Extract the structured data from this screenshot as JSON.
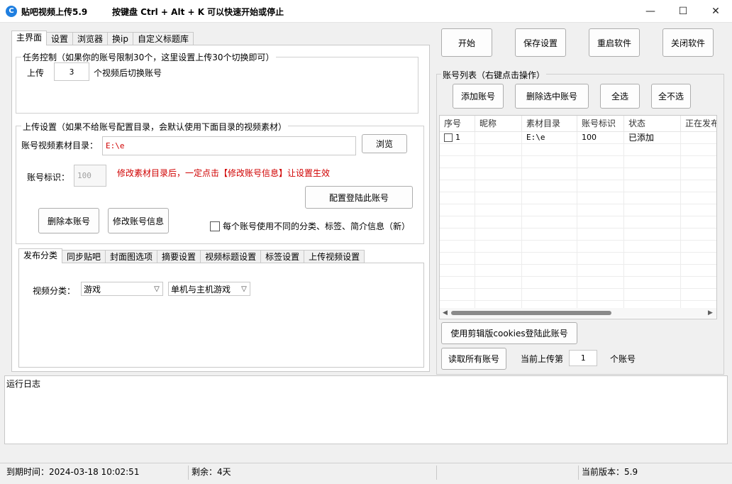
{
  "window": {
    "title": "贴吧视频上传5.9",
    "hotkey_hint": "按键盘 Ctrl + Alt + K  可以快速开始或停止",
    "icon_text": "C",
    "minimize": "—",
    "maximize": "☐",
    "close": "✕"
  },
  "main_tabs": [
    "主界面",
    "设置",
    "浏览器",
    "换ip",
    "自定义标题库"
  ],
  "task_control": {
    "legend": "任务控制（如果你的账号限制30个，这里设置上传30个切换即可）",
    "prefix": "上传",
    "count": "3",
    "suffix": "个视频后切换账号"
  },
  "upload_settings": {
    "legend": "上传设置（如果不给账号配置目录，会默认使用下面目录的视频素材）",
    "dir_label": "账号视频素材目录：",
    "dir_value": "E:\\e",
    "browse_button": "浏览",
    "id_label": "账号标识：",
    "id_placeholder": "100",
    "warning": "修改素材目录后，一定点击【修改账号信息】让设置生效",
    "login_button": "配置登陆此账号",
    "delete_button": "删除本账号",
    "modify_button": "修改账号信息",
    "per_account_checkbox": "每个账号使用不同的分类、标签、简介信息（新）"
  },
  "sub_tabs": [
    "发布分类",
    "同步贴吧",
    "封面图选项",
    "摘要设置",
    "视频标题设置",
    "标签设置",
    "上传视频设置"
  ],
  "category": {
    "label": "视频分类：",
    "primary": "游戏",
    "secondary": "单机与主机游戏"
  },
  "top_buttons": {
    "start": "开始",
    "save": "保存设置",
    "restart": "重启软件",
    "close": "关闭软件"
  },
  "accounts": {
    "legend": "账号列表（右键点击操作）",
    "add_button": "添加账号",
    "delete_selected_button": "删除选中账号",
    "select_all_button": "全选",
    "select_none_button": "全不选",
    "columns": [
      "序号",
      "昵称",
      "素材目录",
      "账号标识",
      "状态",
      "正在发布"
    ],
    "rows": [
      {
        "index": "1",
        "nickname": "",
        "dir": "E:\\e",
        "id": "100",
        "status": "已添加",
        "publishing": ""
      }
    ],
    "cookies_login_button": "使用剪辑版cookies登陆此账号",
    "read_all_button": "读取所有账号",
    "current_label": "当前上传第",
    "current_value": "1",
    "current_suffix": "个账号"
  },
  "log": {
    "label": "运行日志"
  },
  "status": {
    "expire": "到期时间：2024-03-18 10:02:51",
    "remaining": "剩余：4天",
    "version": "当前版本：5.9"
  }
}
